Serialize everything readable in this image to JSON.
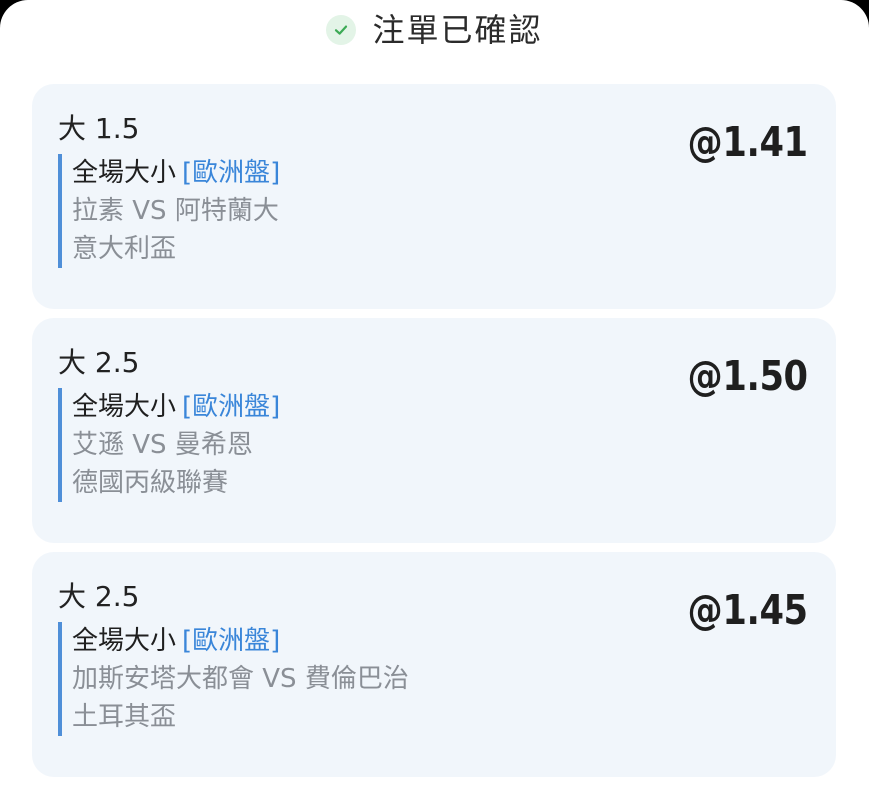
{
  "header": {
    "title": "注單已確認",
    "icon": "check-icon",
    "icon_color": "#3caa55"
  },
  "colors": {
    "accent_blue": "#3a86d9",
    "card_bg": "#f1f6fb",
    "muted_text": "#8a8f96"
  },
  "bets": [
    {
      "selection": "大 1.5",
      "odds": "@1.41",
      "market": "全場大小",
      "market_type": "[歐洲盤]",
      "teams": "拉素 VS 阿特蘭大",
      "league": "意大利盃"
    },
    {
      "selection": "大 2.5",
      "odds": "@1.50",
      "market": "全場大小",
      "market_type": "[歐洲盤]",
      "teams": "艾遜 VS 曼希恩",
      "league": "德國丙級聯賽"
    },
    {
      "selection": "大 2.5",
      "odds": "@1.45",
      "market": "全場大小",
      "market_type": "[歐洲盤]",
      "teams": "加斯安塔大都會 VS 費倫巴治",
      "league": "土耳其盃"
    }
  ]
}
